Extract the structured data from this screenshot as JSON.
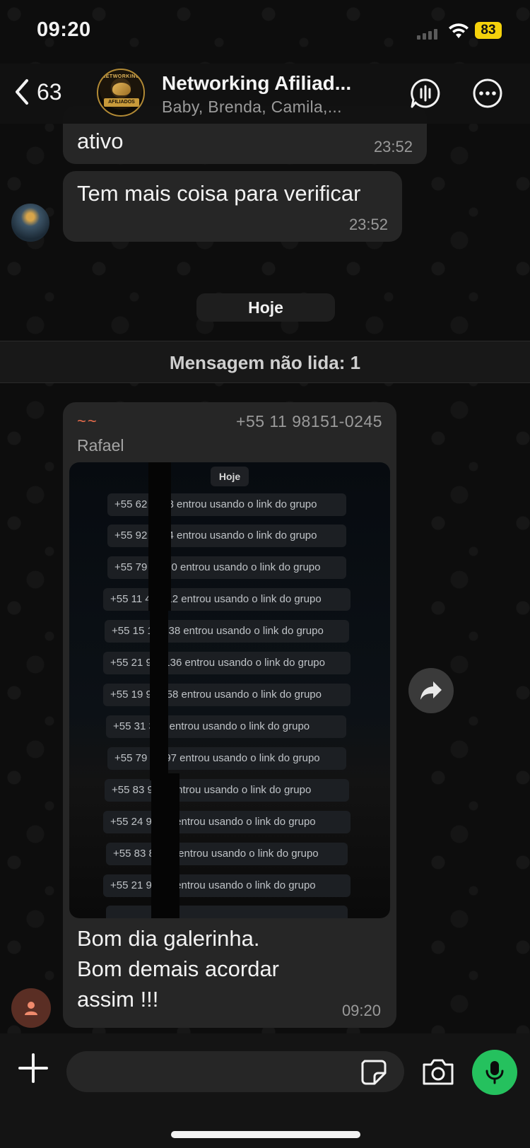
{
  "status_bar": {
    "time": "09:20",
    "battery": "83"
  },
  "header": {
    "back_count": "63",
    "group_name": "Networking Afiliad...",
    "members": "Baby, Brenda, Camila,...",
    "avatar_text_top": "NETWORKING",
    "avatar_text_label": "AFILIADOS"
  },
  "messages": [
    {
      "text": "ativo",
      "time": "23:52"
    },
    {
      "text": "Tem mais coisa para verificar",
      "time": "23:52"
    }
  ],
  "day_chip": "Hoje",
  "unread_banner": "Mensagem não lida: 1",
  "image_message": {
    "sender_tag": "~~",
    "sender_phone": "+55 11 98151-0245",
    "sender_name": "Rafael",
    "screenshot": {
      "day_chip": "Hoje",
      "rows": [
        "+55 62        4748 entrou usando o link do grupo",
        "+55 92        3524 entrou usando o link do grupo",
        "+55 79        -8700 entrou usando o link do grupo",
        "+55 11        4-5812 entrou usando o link do grupo",
        "+55 15        1-6138 entrou usando o link do grupo",
        "+55 21 9      -6136 entrou usando o link do grupo",
        "+55 19 9      6058 entrou usando o link do grupo",
        "+55 31        349 entrou usando o link do grupo",
        "+55 79 8      097 entrou usando o link do grupo",
        "+55 83 9      87 entrou usando o link do grupo",
        "+55 24 9      202 entrou usando o link do grupo",
        "+55 83 8      478 entrou usando o link do grupo",
        "+55 21 9      842 entrou usando o link do grupo"
      ]
    },
    "caption_line1": "Bom dia galerinha.",
    "caption_line2": "Bom demais acordar",
    "caption_line3": "assim !!!",
    "time": "09:20"
  },
  "composer": {
    "placeholder": ""
  },
  "colors": {
    "accent_green": "#25c15e",
    "battery": "#f5d20b",
    "bubble": "#262626",
    "sender_tag": "#e86c4c"
  }
}
